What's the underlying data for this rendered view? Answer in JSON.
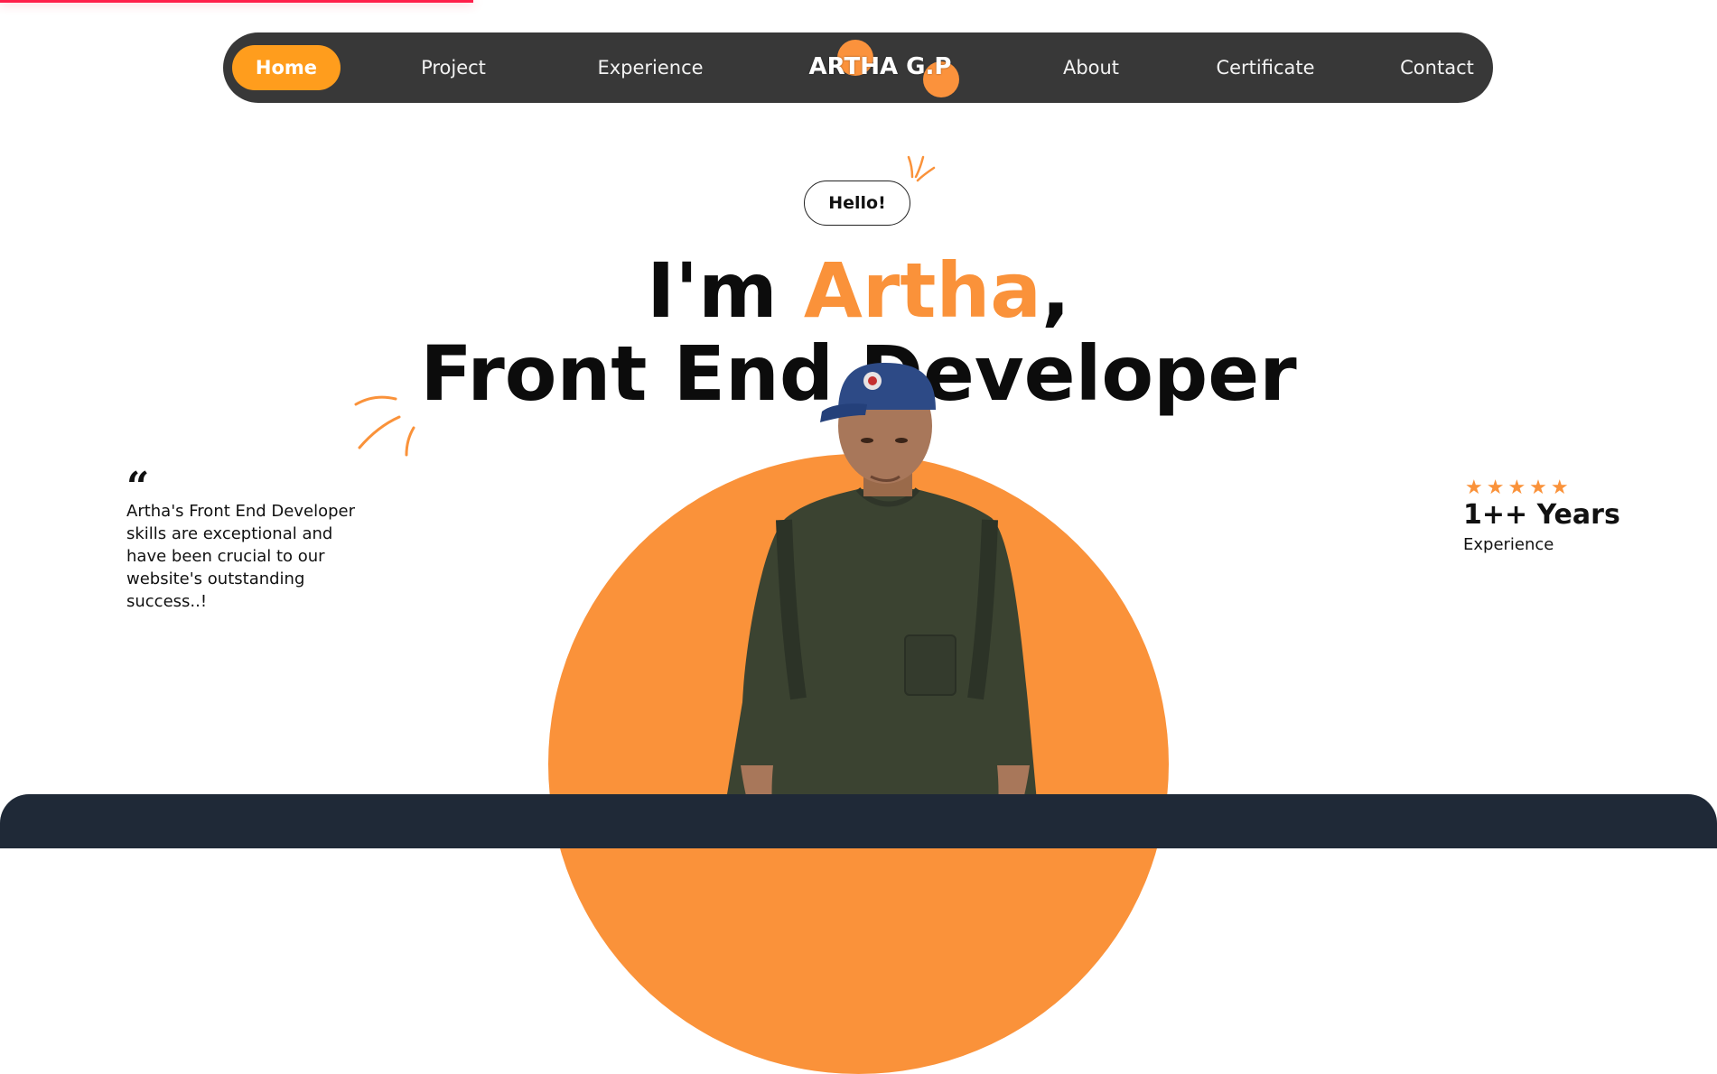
{
  "nav": {
    "items": [
      "Home",
      "Project",
      "Experience",
      "About",
      "Certificate",
      "Contact"
    ],
    "logo": "ARTHA G.P"
  },
  "hero": {
    "greeting": "Hello!",
    "line1_prefix": "I'm ",
    "name": "Artha",
    "line1_suffix": ",",
    "line2": "Front End Developer"
  },
  "testimonial": {
    "quote_icon": "quote-icon",
    "text": "Artha's Front End Developer skills are exceptional and have been crucial to our website's outstanding success..!"
  },
  "stats": {
    "stars": "★★★★★",
    "value": "1++ Years",
    "label": "Experience"
  },
  "colors": {
    "accent": "#fa923a",
    "nav_background": "#383838",
    "active_nav": "#ff9d1d",
    "progress": "#ff1f4b",
    "footer": "#1f2937"
  }
}
